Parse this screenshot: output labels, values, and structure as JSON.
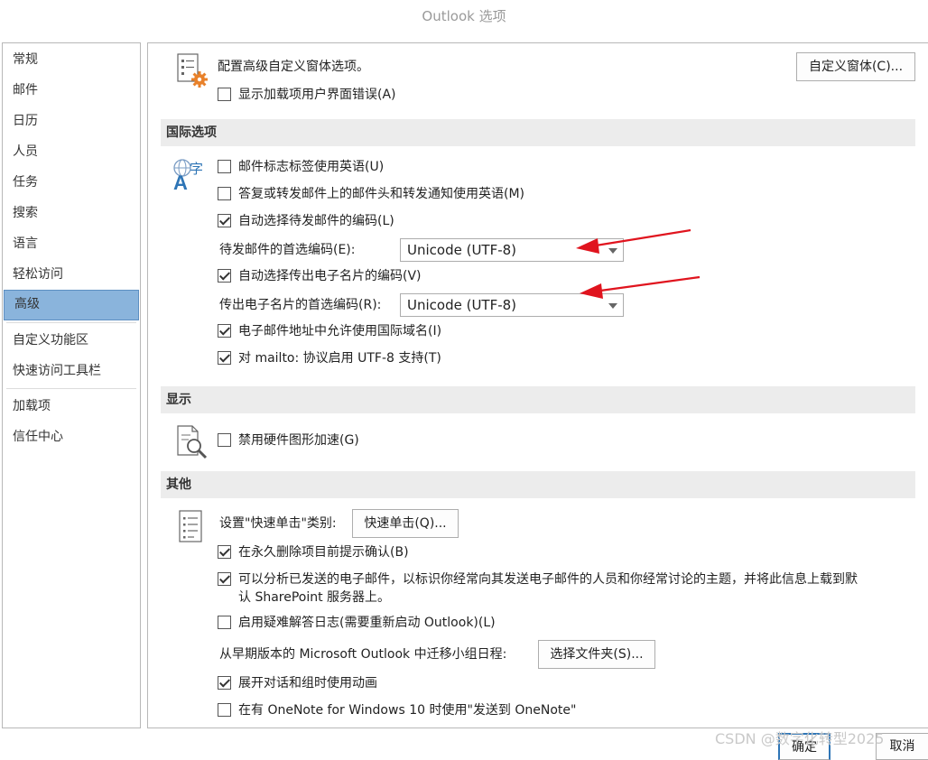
{
  "window": {
    "title": "Outlook 选项"
  },
  "sidebar": {
    "items": [
      {
        "label": "常规"
      },
      {
        "label": "邮件"
      },
      {
        "label": "日历"
      },
      {
        "label": "人员"
      },
      {
        "label": "任务"
      },
      {
        "label": "搜索"
      },
      {
        "label": "语言"
      },
      {
        "label": "轻松访问"
      },
      {
        "label": "高级",
        "selected": true
      },
      {
        "label": "自定义功能区"
      },
      {
        "label": "快速访问工具栏"
      },
      {
        "label": "加载项"
      },
      {
        "label": "信任中心"
      }
    ]
  },
  "custom_forms": {
    "text": "配置高级自定义窗体选项。",
    "button_label": "自定义窗体(C)...",
    "show_addin_errors": {
      "label": "显示加载项用户界面错误(A)",
      "checked": false
    }
  },
  "international": {
    "header": "国际选项",
    "flag_labels_english": {
      "label": "邮件标志标签使用英语(U)",
      "checked": false
    },
    "reply_forward_english": {
      "label": "答复或转发邮件上的邮件头和转发通知使用英语(M)",
      "checked": false
    },
    "auto_select_outgoing_encoding": {
      "label": "自动选择待发邮件的编码(L)",
      "checked": true
    },
    "outgoing_encoding_label": "待发邮件的首选编码(E):",
    "outgoing_encoding_value": "Unicode (UTF-8)",
    "auto_select_vcard_encoding": {
      "label": "自动选择传出电子名片的编码(V)",
      "checked": true
    },
    "vcard_encoding_label": "传出电子名片的首选编码(R):",
    "vcard_encoding_value": "Unicode (UTF-8)",
    "allow_international_domains": {
      "label": "电子邮件地址中允许使用国际域名(I)",
      "checked": true
    },
    "mailto_utf8": {
      "label": "对 mailto: 协议启用 UTF-8 支持(T)",
      "checked": true
    }
  },
  "display": {
    "header": "显示",
    "disable_hw_accel": {
      "label": "禁用硬件图形加速(G)",
      "checked": false
    }
  },
  "other": {
    "header": "其他",
    "quick_click_label": "设置\"快速单击\"类别:",
    "quick_click_button": "快速单击(Q)...",
    "prompt_before_delete": {
      "label": "在永久删除项目前提示确认(B)",
      "checked": true
    },
    "analyze_sent": {
      "label_line1": "可以分析已发送的电子邮件，以标识你经常向其发送电子邮件的人员和你经常讨论的主题，并将此信息上载到默",
      "label_line2": "认 SharePoint 服务器上。",
      "checked": true
    },
    "troubleshoot_log": {
      "label": "启用疑难解答日志(需要重新启动 Outlook)(L)",
      "checked": false
    },
    "migrate_label": "从早期版本的 Microsoft Outlook 中迁移小组日程:",
    "choose_folder_button": "选择文件夹(S)...",
    "animations": {
      "label": "展开对话和组时使用动画",
      "checked": true
    },
    "onenote": {
      "label": "在有 OneNote for Windows 10 时使用\"发送到 OneNote\"",
      "checked": false
    }
  },
  "footer": {
    "ok_label": "确定",
    "cancel_label": "取消"
  },
  "watermark": "CSDN @数字化转型2025",
  "colors": {
    "selected_nav": "#8ab4dc",
    "arrow": "#e0141e",
    "section_header": "#ececec"
  }
}
